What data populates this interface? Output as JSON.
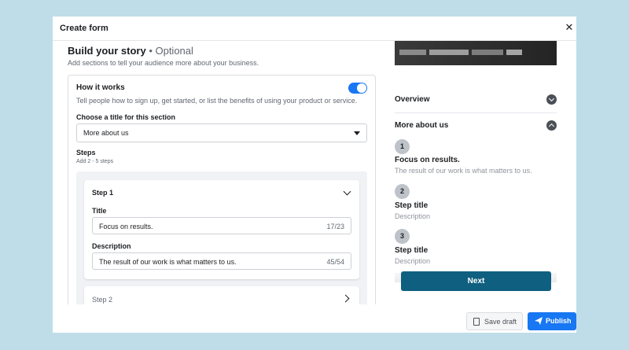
{
  "modal": {
    "title": "Create form",
    "close_icon": "✕"
  },
  "story": {
    "title": "Build your story",
    "optional": "• Optional",
    "subtitle": "Add sections to tell your audience more about your business."
  },
  "how_it_works": {
    "title": "How it works",
    "description": "Tell people how to sign up, get started, or list the benefits of using your product or service.",
    "toggle_on": true,
    "choose_label": "Choose a title for this section",
    "selected_title": "More about us",
    "steps_label": "Steps",
    "steps_hint": "Add 2 - 5 steps"
  },
  "step1": {
    "header": "Step 1",
    "title_label": "Title",
    "title_value": "Focus on results.",
    "title_count": "17/23",
    "desc_label": "Description",
    "desc_value": "The result of our work is what matters to us.",
    "desc_count": "45/54"
  },
  "step2": {
    "header": "Step 2"
  },
  "preview": {
    "overview_label": "Overview",
    "more_about_label": "More about us",
    "items": [
      {
        "num": "1",
        "title": "Focus on results.",
        "desc": "The result of our work is what matters to us."
      },
      {
        "num": "2",
        "title": "Step title",
        "desc": "Description"
      },
      {
        "num": "3",
        "title": "Step title",
        "desc": "Description"
      }
    ],
    "next_label": "Next"
  },
  "footer": {
    "save_draft_label": "Save draft",
    "publish_label": "Publish"
  },
  "colors": {
    "accent": "#1877f2",
    "next_button": "#0f5f80",
    "background": "#bfdde8"
  }
}
